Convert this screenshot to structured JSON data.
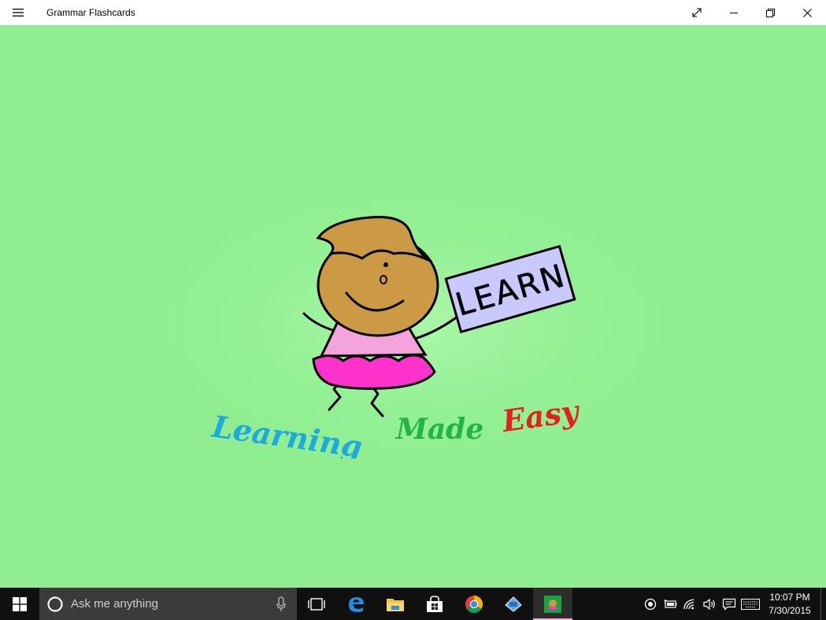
{
  "window": {
    "title": "Grammar Flashcards"
  },
  "splash": {
    "sign_text": "LEARN",
    "tagline": {
      "word1": "Learning",
      "word2": "Made",
      "word3": "Easy"
    },
    "colors": {
      "background": "#90ee90",
      "word1": "#1fa9e1",
      "word2": "#24b34b",
      "word3": "#e8201c",
      "skin": "#cc9944",
      "shirt": "#f5a3dd",
      "skirt": "#ff33cc",
      "sign": "#c9c8ff"
    }
  },
  "taskbar": {
    "search_placeholder": "Ask me anything",
    "pinned_icons": [
      "task-view-icon",
      "edge-icon",
      "file-explorer-icon",
      "store-icon",
      "chrome-icon",
      "remote-desktop-icon",
      "grammar-flashcards-app-icon"
    ],
    "clock": {
      "time": "10:07 PM",
      "date": "7/30/2015"
    }
  }
}
